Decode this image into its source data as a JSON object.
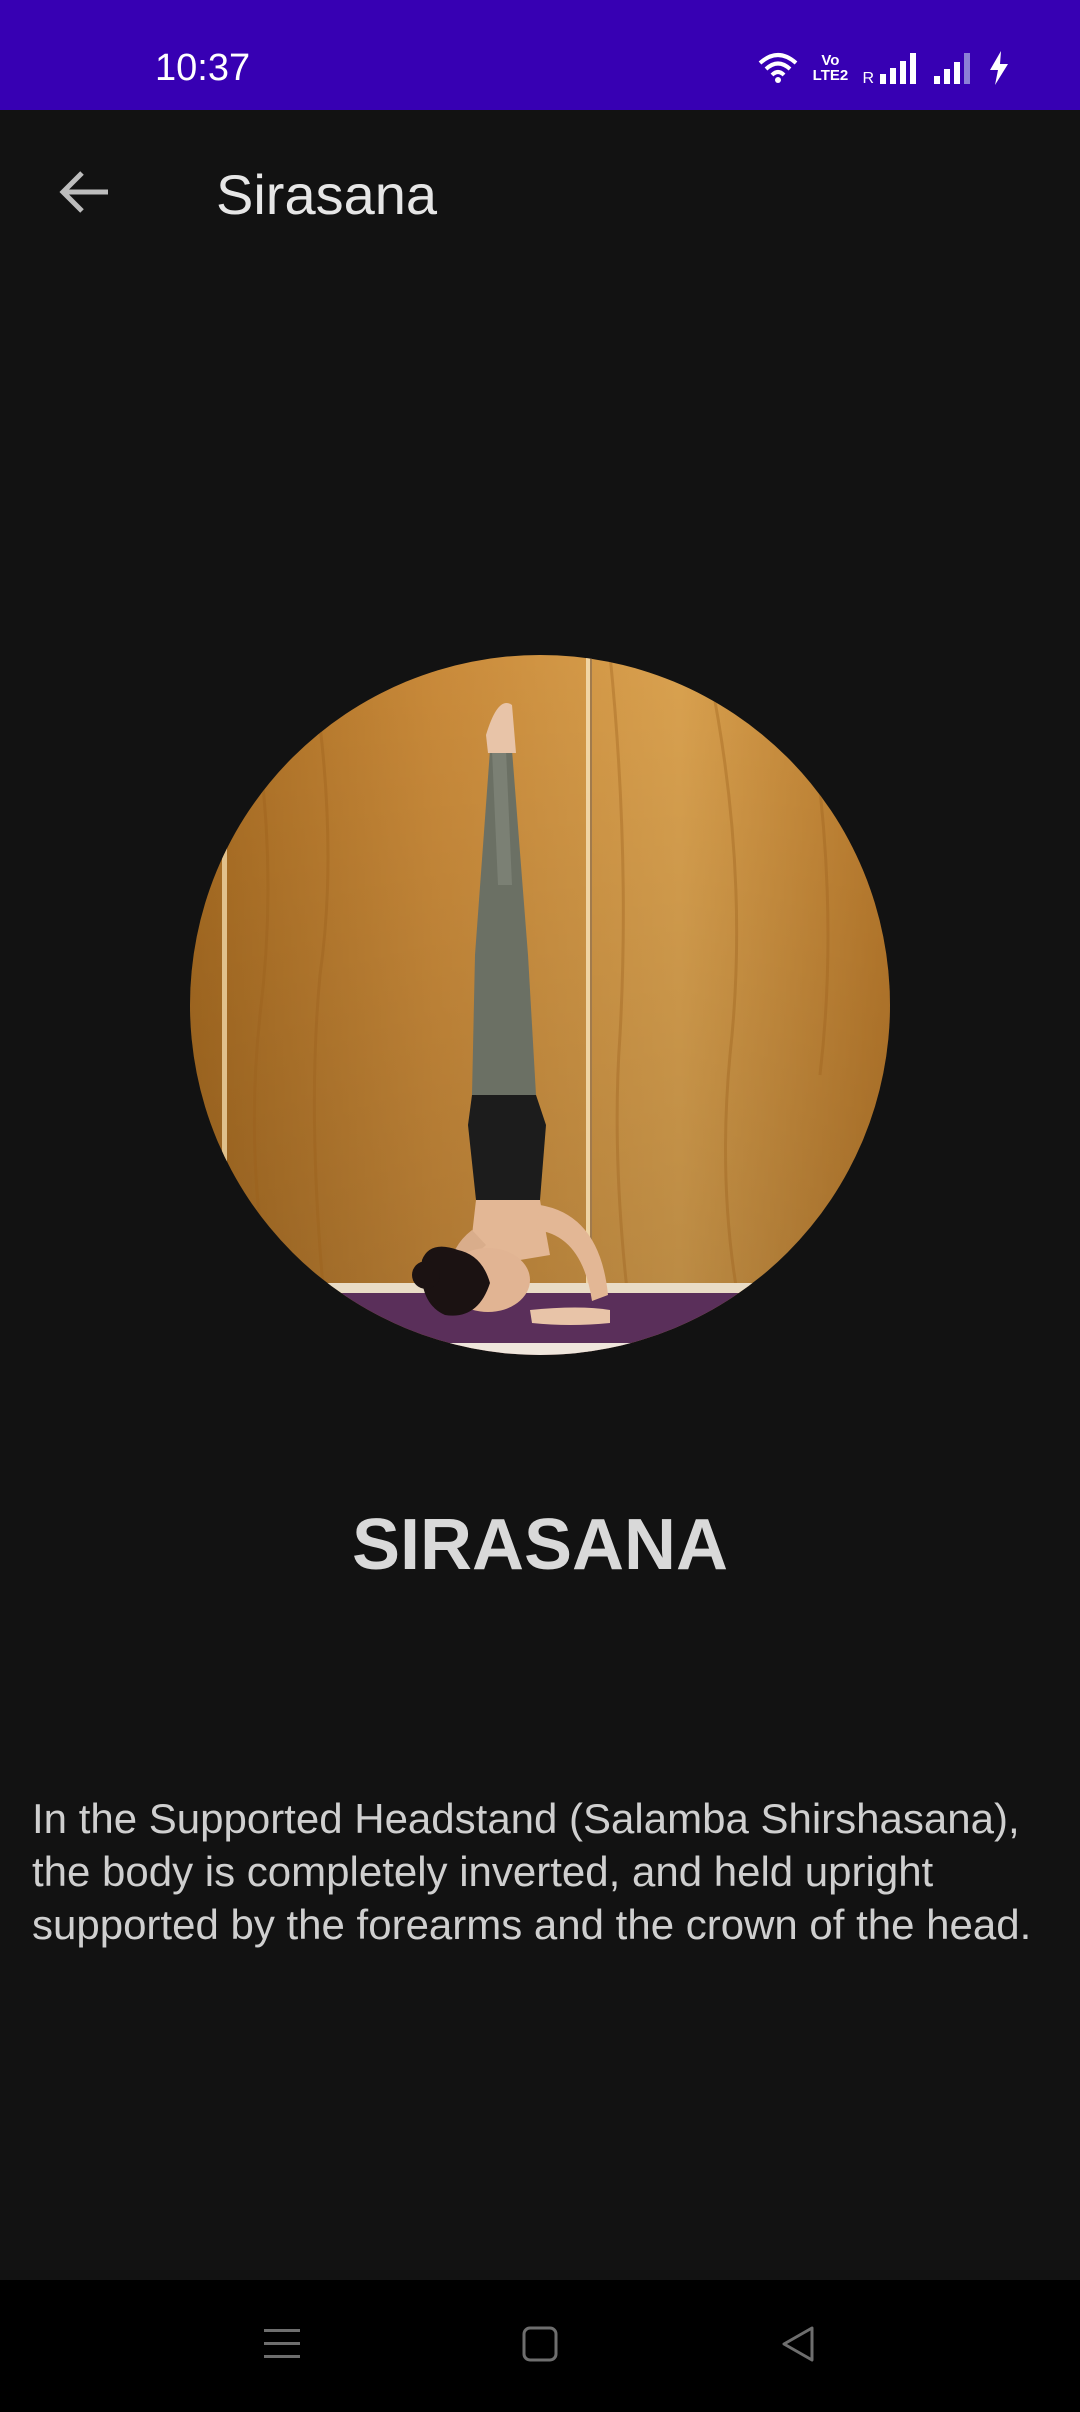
{
  "status_bar": {
    "time": "10:37",
    "icons": [
      "wifi-icon",
      "volte-icon",
      "signal-icon",
      "signal-icon",
      "charging-icon"
    ],
    "volte_top": "Vo",
    "volte_bottom": "LTE2",
    "roaming": "R",
    "background": "#3700b3"
  },
  "app_bar": {
    "back_icon": "arrow-left-icon",
    "title": "Sirasana"
  },
  "pose": {
    "image_icon": "headstand-photo",
    "name": "SIRASANA",
    "description": "In the Supported Headstand (Salamba Shirshasana), the body is completely inverted, and held upright supported by the forearms and the crown of the head."
  },
  "nav_bar": {
    "items": [
      "menu-icon",
      "home-square-icon",
      "back-triangle-icon"
    ]
  },
  "colors": {
    "background": "#121212",
    "heading_text": "#d9d9d9",
    "body_text": "#cfcfcf"
  }
}
